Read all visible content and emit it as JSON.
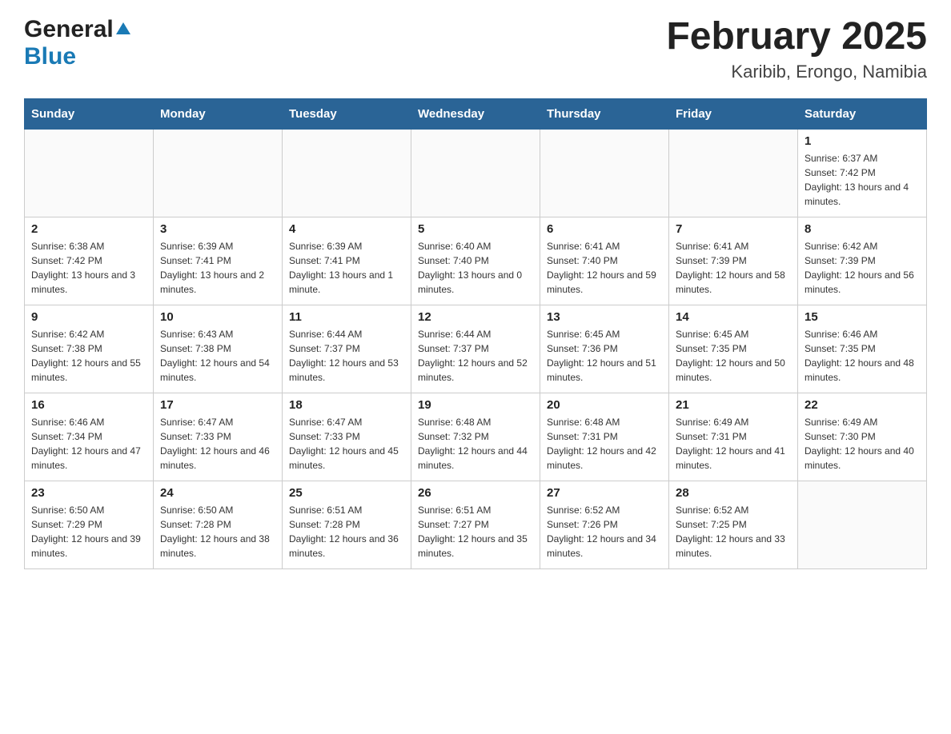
{
  "header": {
    "logo": {
      "general": "General",
      "blue": "Blue"
    },
    "title": "February 2025",
    "subtitle": "Karibib, Erongo, Namibia"
  },
  "calendar": {
    "days_of_week": [
      "Sunday",
      "Monday",
      "Tuesday",
      "Wednesday",
      "Thursday",
      "Friday",
      "Saturday"
    ],
    "weeks": [
      {
        "days": [
          {
            "number": "",
            "info": ""
          },
          {
            "number": "",
            "info": ""
          },
          {
            "number": "",
            "info": ""
          },
          {
            "number": "",
            "info": ""
          },
          {
            "number": "",
            "info": ""
          },
          {
            "number": "",
            "info": ""
          },
          {
            "number": "1",
            "info": "Sunrise: 6:37 AM\nSunset: 7:42 PM\nDaylight: 13 hours and 4 minutes."
          }
        ]
      },
      {
        "days": [
          {
            "number": "2",
            "info": "Sunrise: 6:38 AM\nSunset: 7:42 PM\nDaylight: 13 hours and 3 minutes."
          },
          {
            "number": "3",
            "info": "Sunrise: 6:39 AM\nSunset: 7:41 PM\nDaylight: 13 hours and 2 minutes."
          },
          {
            "number": "4",
            "info": "Sunrise: 6:39 AM\nSunset: 7:41 PM\nDaylight: 13 hours and 1 minute."
          },
          {
            "number": "5",
            "info": "Sunrise: 6:40 AM\nSunset: 7:40 PM\nDaylight: 13 hours and 0 minutes."
          },
          {
            "number": "6",
            "info": "Sunrise: 6:41 AM\nSunset: 7:40 PM\nDaylight: 12 hours and 59 minutes."
          },
          {
            "number": "7",
            "info": "Sunrise: 6:41 AM\nSunset: 7:39 PM\nDaylight: 12 hours and 58 minutes."
          },
          {
            "number": "8",
            "info": "Sunrise: 6:42 AM\nSunset: 7:39 PM\nDaylight: 12 hours and 56 minutes."
          }
        ]
      },
      {
        "days": [
          {
            "number": "9",
            "info": "Sunrise: 6:42 AM\nSunset: 7:38 PM\nDaylight: 12 hours and 55 minutes."
          },
          {
            "number": "10",
            "info": "Sunrise: 6:43 AM\nSunset: 7:38 PM\nDaylight: 12 hours and 54 minutes."
          },
          {
            "number": "11",
            "info": "Sunrise: 6:44 AM\nSunset: 7:37 PM\nDaylight: 12 hours and 53 minutes."
          },
          {
            "number": "12",
            "info": "Sunrise: 6:44 AM\nSunset: 7:37 PM\nDaylight: 12 hours and 52 minutes."
          },
          {
            "number": "13",
            "info": "Sunrise: 6:45 AM\nSunset: 7:36 PM\nDaylight: 12 hours and 51 minutes."
          },
          {
            "number": "14",
            "info": "Sunrise: 6:45 AM\nSunset: 7:35 PM\nDaylight: 12 hours and 50 minutes."
          },
          {
            "number": "15",
            "info": "Sunrise: 6:46 AM\nSunset: 7:35 PM\nDaylight: 12 hours and 48 minutes."
          }
        ]
      },
      {
        "days": [
          {
            "number": "16",
            "info": "Sunrise: 6:46 AM\nSunset: 7:34 PM\nDaylight: 12 hours and 47 minutes."
          },
          {
            "number": "17",
            "info": "Sunrise: 6:47 AM\nSunset: 7:33 PM\nDaylight: 12 hours and 46 minutes."
          },
          {
            "number": "18",
            "info": "Sunrise: 6:47 AM\nSunset: 7:33 PM\nDaylight: 12 hours and 45 minutes."
          },
          {
            "number": "19",
            "info": "Sunrise: 6:48 AM\nSunset: 7:32 PM\nDaylight: 12 hours and 44 minutes."
          },
          {
            "number": "20",
            "info": "Sunrise: 6:48 AM\nSunset: 7:31 PM\nDaylight: 12 hours and 42 minutes."
          },
          {
            "number": "21",
            "info": "Sunrise: 6:49 AM\nSunset: 7:31 PM\nDaylight: 12 hours and 41 minutes."
          },
          {
            "number": "22",
            "info": "Sunrise: 6:49 AM\nSunset: 7:30 PM\nDaylight: 12 hours and 40 minutes."
          }
        ]
      },
      {
        "days": [
          {
            "number": "23",
            "info": "Sunrise: 6:50 AM\nSunset: 7:29 PM\nDaylight: 12 hours and 39 minutes."
          },
          {
            "number": "24",
            "info": "Sunrise: 6:50 AM\nSunset: 7:28 PM\nDaylight: 12 hours and 38 minutes."
          },
          {
            "number": "25",
            "info": "Sunrise: 6:51 AM\nSunset: 7:28 PM\nDaylight: 12 hours and 36 minutes."
          },
          {
            "number": "26",
            "info": "Sunrise: 6:51 AM\nSunset: 7:27 PM\nDaylight: 12 hours and 35 minutes."
          },
          {
            "number": "27",
            "info": "Sunrise: 6:52 AM\nSunset: 7:26 PM\nDaylight: 12 hours and 34 minutes."
          },
          {
            "number": "28",
            "info": "Sunrise: 6:52 AM\nSunset: 7:25 PM\nDaylight: 12 hours and 33 minutes."
          },
          {
            "number": "",
            "info": ""
          }
        ]
      }
    ]
  }
}
